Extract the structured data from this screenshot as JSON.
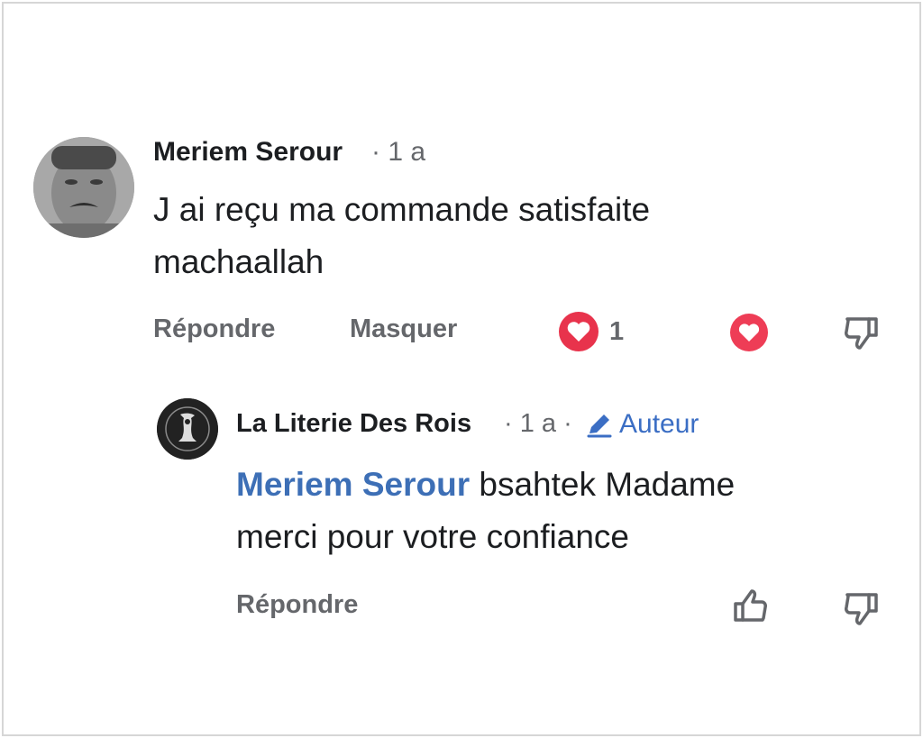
{
  "comment": {
    "author": "Meriem Serour",
    "time": "· 1 a",
    "lines": [
      "J ai reçu ma commande  satisfaite",
      "machaallah"
    ],
    "actions": {
      "reply": "Répondre",
      "hide": "Masquer"
    },
    "reaction_count": "1",
    "reaction_color": "#e8334c"
  },
  "reply": {
    "author": "La Literie Des Rois",
    "time": "· 1 a ·",
    "badge": "Auteur",
    "mention": "Meriem Serour",
    "text_after_mention": " bsahtek Madame",
    "line2": "merci pour votre confiance",
    "actions": {
      "reply": "Répondre"
    }
  },
  "colors": {
    "link": "#3d6fb6",
    "muted": "#65676b",
    "text": "#1c1e21"
  },
  "icons": [
    "heart-reaction-icon",
    "love-react-icon",
    "thumbs-down-icon",
    "thumbs-up-icon",
    "pencil-icon"
  ]
}
